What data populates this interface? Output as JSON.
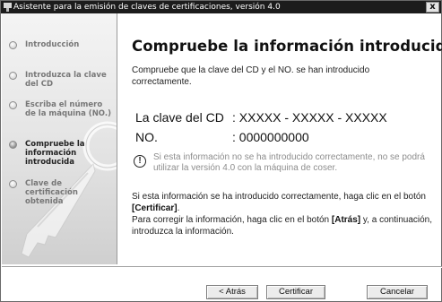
{
  "window": {
    "title": "Asistente para la emisión de claves de certificaciones, versión 4.0",
    "close_label": "x"
  },
  "sidebar": {
    "steps": [
      {
        "label": "Introducción",
        "state": "done"
      },
      {
        "label": "Introduzca la clave del CD",
        "state": "done"
      },
      {
        "label": "Escriba el número de la máquina (NO.)",
        "state": "done"
      },
      {
        "label": "Compruebe la información introducida",
        "state": "current"
      },
      {
        "label": "Clave de certificación obtenida",
        "state": "pending"
      }
    ]
  },
  "main": {
    "heading": "Compruebe la información introducida",
    "description": "Compruebe que la clave del CD y el NO. se han introducido correctamente.",
    "cd_key_label": "La clave del CD",
    "cd_key_value": ": XXXXX - XXXXX - XXXXX",
    "no_label": "NO.",
    "no_value": ": 0000000000",
    "warning_icon_glyph": "!",
    "warning_text": "Si esta información no se ha introducido correctamente, no se podrá utilizar la versión 4.0 con la máquina de coser.",
    "instr_part1": "Si esta información se ha introducido correctamente, haga clic en el botón ",
    "instr_certify": "[Certificar]",
    "instr_part2": ".",
    "instr_part3": "Para corregir la información, haga clic en el botón ",
    "instr_back": "[Atrás]",
    "instr_part4": " y, a continuación, introduzca la información."
  },
  "buttons": {
    "back": "< Atrás",
    "certify": "Certificar",
    "cancel": "Cancelar"
  }
}
